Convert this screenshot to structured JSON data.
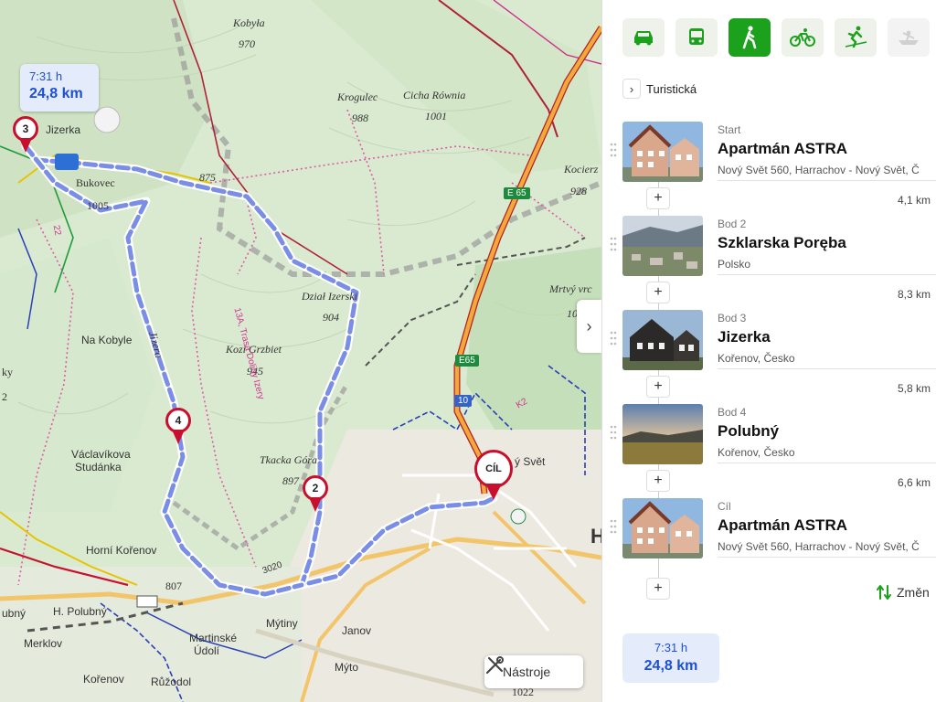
{
  "map": {
    "route_summary": {
      "time": "7:31 h",
      "distance": "24,8 km"
    },
    "places": [
      {
        "text": "Kobyła",
        "style": "it"
      },
      {
        "text": "970",
        "style": "it"
      },
      {
        "text": "Krogulec",
        "style": "it"
      },
      {
        "text": "988",
        "style": "it"
      },
      {
        "text": "Cicha Równia",
        "style": "it"
      },
      {
        "text": "1001",
        "style": "it"
      },
      {
        "text": "Jizerka",
        "style": "sans"
      },
      {
        "text": "875",
        "style": "it"
      },
      {
        "text": "Bukovec",
        "style": ""
      },
      {
        "text": "1005",
        "style": ""
      },
      {
        "text": "Kocierz",
        "style": "it"
      },
      {
        "text": "928",
        "style": "it"
      },
      {
        "text": "Dział Izerski",
        "style": "it"
      },
      {
        "text": "904",
        "style": "it"
      },
      {
        "text": "Mrtvý vrc",
        "style": "it"
      },
      {
        "text": "10",
        "style": "it"
      },
      {
        "text": "Na Kobyle",
        "style": "sans"
      },
      {
        "text": "Kozi Grzbiet",
        "style": "it"
      },
      {
        "text": "945",
        "style": "it"
      },
      {
        "text": "ky",
        "style": ""
      },
      {
        "text": "2",
        "style": ""
      },
      {
        "text": "Jizera",
        "style": "it"
      },
      {
        "text": "13A, Trasa Doliny Izery",
        "style": "sans"
      },
      {
        "text": "Václavíkova",
        "style": "sans"
      },
      {
        "text": "Studánka",
        "style": "sans"
      },
      {
        "text": "Tkacka Góra",
        "style": "it"
      },
      {
        "text": "897",
        "style": "it"
      },
      {
        "text": "ý Svět",
        "style": "sans"
      },
      {
        "text": "Horní Kořenov",
        "style": "sans"
      },
      {
        "text": "807",
        "style": ""
      },
      {
        "text": "ubný",
        "style": "sans"
      },
      {
        "text": "H. Polubný",
        "style": "sans"
      },
      {
        "text": "Mýtiny",
        "style": "sans"
      },
      {
        "text": "Janov",
        "style": "sans"
      },
      {
        "text": "Merklov",
        "style": "sans"
      },
      {
        "text": "Martinské",
        "style": "sans"
      },
      {
        "text": "Údolí",
        "style": "sans"
      },
      {
        "text": "Kořenov",
        "style": "sans"
      },
      {
        "text": "Růžodol",
        "style": "sans"
      },
      {
        "text": "Mýto",
        "style": "sans"
      },
      {
        "text": "1022",
        "style": ""
      },
      {
        "text": "H",
        "style": "sans"
      },
      {
        "text": "3020",
        "style": "sans"
      },
      {
        "text": "22",
        "style": "sans"
      },
      {
        "text": "K2",
        "style": "sans"
      }
    ],
    "roads": {
      "e65_top": "E 65",
      "e65_mid": "E65",
      "r10": "10"
    },
    "markers": {
      "m3": "3",
      "m4": "4",
      "m2": "2",
      "cil": "CÍL"
    },
    "tools_label": "Nástroje",
    "collapse_icon": "›"
  },
  "panel": {
    "modes": [
      {
        "name": "car",
        "active": false,
        "disabled": false
      },
      {
        "name": "bus",
        "active": false,
        "disabled": false
      },
      {
        "name": "walk",
        "active": true,
        "disabled": false
      },
      {
        "name": "bike",
        "active": false,
        "disabled": false
      },
      {
        "name": "ski",
        "active": false,
        "disabled": false
      },
      {
        "name": "boat",
        "active": false,
        "disabled": true
      }
    ],
    "subtype_label": "Turistická",
    "stops": [
      {
        "role": "Start",
        "name": "Apartmán ASTRA",
        "address": "Nový Svět 560, Harrachov - Nový Svět, Č"
      },
      {
        "role": "Bod 2",
        "name": "Szklarska Poręba",
        "address": "Polsko"
      },
      {
        "role": "Bod 3",
        "name": "Jizerka",
        "address": "Kořenov, Česko"
      },
      {
        "role": "Bod 4",
        "name": "Polubný",
        "address": "Kořenov, Česko"
      },
      {
        "role": "Cíl",
        "name": "Apartmán ASTRA",
        "address": "Nový Svět 560, Harrachov - Nový Svět, Č"
      }
    ],
    "segments": [
      "4,1 km",
      "8,3 km",
      "5,8 km",
      "6,6 km"
    ],
    "add_label": "+",
    "swap_label": "Změn",
    "summary": {
      "time": "7:31 h",
      "distance": "24,8 km"
    },
    "colors": {
      "accent": "#1ba11b",
      "route": "#1c4fd6",
      "marker": "#c8102e"
    }
  }
}
